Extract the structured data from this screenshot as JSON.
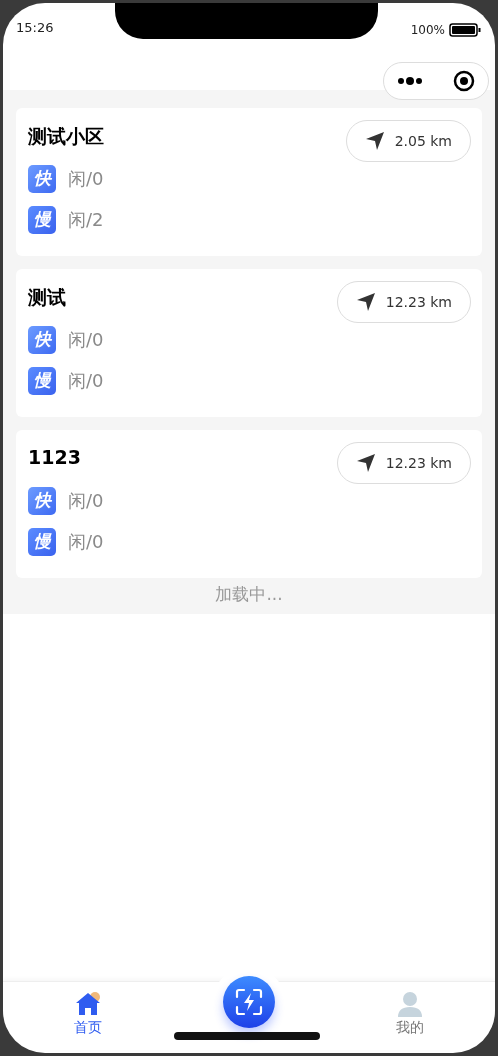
{
  "status_bar": {
    "time": "15:26",
    "battery": "100%"
  },
  "stations": [
    {
      "name": "测试小区",
      "distance": "2.05 km",
      "chargers": [
        {
          "kind": "fast",
          "badge": "快",
          "status": "闲/0"
        },
        {
          "kind": "slow",
          "badge": "慢",
          "status": "闲/2"
        }
      ]
    },
    {
      "name": "测试",
      "distance": "12.23 km",
      "chargers": [
        {
          "kind": "fast",
          "badge": "快",
          "status": "闲/0"
        },
        {
          "kind": "slow",
          "badge": "慢",
          "status": "闲/0"
        }
      ]
    },
    {
      "name": "1123",
      "distance": "12.23 km",
      "chargers": [
        {
          "kind": "fast",
          "badge": "快",
          "status": "闲/0"
        },
        {
          "kind": "slow",
          "badge": "慢",
          "status": "闲/0"
        }
      ]
    }
  ],
  "loading_text": "加载中...",
  "tab_bar": [
    {
      "kind": "home",
      "label": "首页",
      "selected": true
    },
    {
      "kind": "scan"
    },
    {
      "kind": "profile",
      "label": "我的",
      "selected": false
    }
  ]
}
